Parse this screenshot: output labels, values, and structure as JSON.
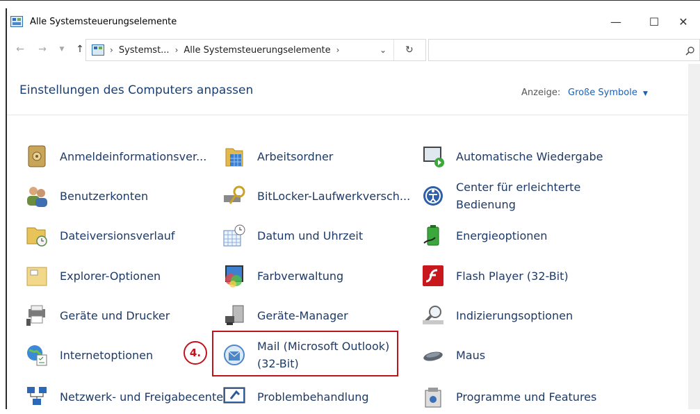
{
  "window": {
    "title": "Alle Systemsteuerungselemente",
    "minimize_glyph": "—",
    "maximize_glyph": "☐",
    "close_glyph": "✕"
  },
  "address": {
    "crumbs": [
      "Systemst...",
      "Alle Systemsteuerungselemente"
    ],
    "search_placeholder": ""
  },
  "content": {
    "heading": "Einstellungen des Computers anpassen",
    "view_label": "Anzeige:",
    "view_value": "Große Symbole"
  },
  "items": [
    {
      "label": "Anmeldeinformationsver...",
      "icon": "credential-vault-icon"
    },
    {
      "label": "Arbeitsordner",
      "icon": "work-folders-icon"
    },
    {
      "label": "Automatische Wiedergabe",
      "icon": "autoplay-icon"
    },
    {
      "label": "Benutzerkonten",
      "icon": "user-accounts-icon"
    },
    {
      "label": "BitLocker-Laufwerkversch...",
      "icon": "bitlocker-icon"
    },
    {
      "label": "Center für erleichterte Bedienung",
      "icon": "ease-of-access-icon"
    },
    {
      "label": "Dateiversionsverlauf",
      "icon": "file-history-icon"
    },
    {
      "label": "Datum und Uhrzeit",
      "icon": "date-time-icon"
    },
    {
      "label": "Energieoptionen",
      "icon": "power-options-icon"
    },
    {
      "label": "Explorer-Optionen",
      "icon": "explorer-options-icon"
    },
    {
      "label": "Farbverwaltung",
      "icon": "color-management-icon"
    },
    {
      "label": "Flash Player (32-Bit)",
      "icon": "flash-player-icon"
    },
    {
      "label": "Geräte und Drucker",
      "icon": "devices-printers-icon"
    },
    {
      "label": "Geräte-Manager",
      "icon": "device-manager-icon"
    },
    {
      "label": "Indizierungsoptionen",
      "icon": "indexing-options-icon"
    },
    {
      "label": "Internetoptionen",
      "icon": "internet-options-icon"
    },
    {
      "label": "Mail (Microsoft Outlook) (32-Bit)",
      "icon": "mail-icon"
    },
    {
      "label": "Maus",
      "icon": "mouse-icon"
    },
    {
      "label": "Netzwerk- und Freigabecenter",
      "icon": "network-sharing-icon"
    },
    {
      "label": "Problembehandlung",
      "icon": "troubleshooting-icon"
    },
    {
      "label": "Programme und Features",
      "icon": "programs-features-icon"
    }
  ],
  "annotation": {
    "step_label": "4.",
    "color": "#c0141c"
  }
}
